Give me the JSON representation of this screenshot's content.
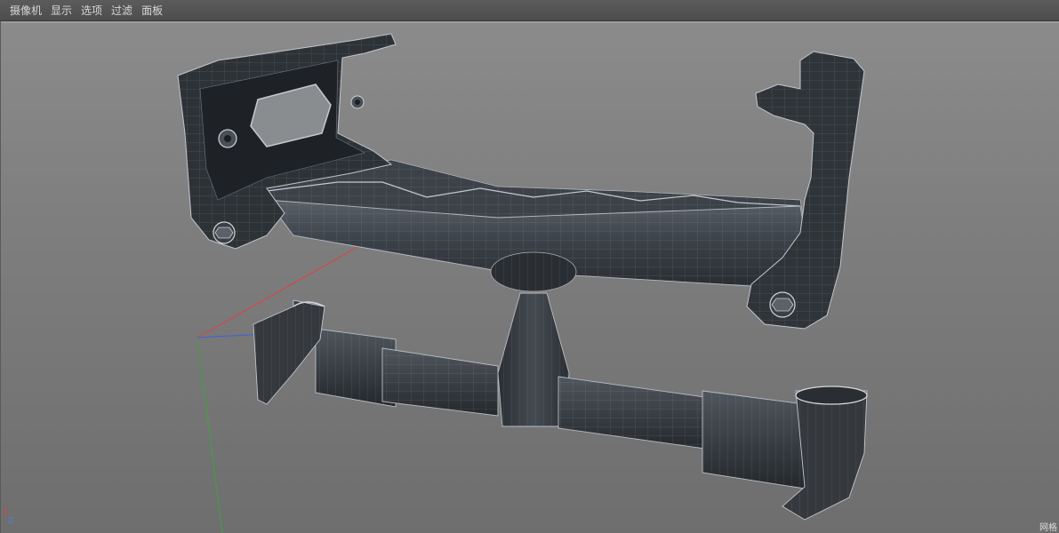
{
  "menubar": {
    "items": [
      {
        "label": "摄像机"
      },
      {
        "label": "显示"
      },
      {
        "label": "选项"
      },
      {
        "label": "过滤"
      },
      {
        "label": "面板"
      }
    ]
  },
  "viewport": {
    "axis_labels": {
      "x": "X",
      "z": "Z"
    },
    "corner_label": "网格",
    "axis_colors": {
      "x": "#e04040",
      "y": "#40b040",
      "z": "#4060e0"
    },
    "model_color": "#3a3f45"
  }
}
